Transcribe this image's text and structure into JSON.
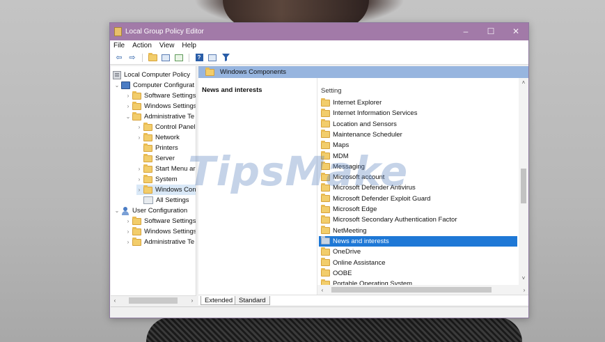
{
  "window": {
    "title": "Local Group Policy Editor",
    "minimize": "–",
    "maximize": "☐",
    "close": "✕"
  },
  "menu": [
    "File",
    "Action",
    "View",
    "Help"
  ],
  "toolbar": {
    "back_icon": "⇦",
    "forward_icon": "⇨"
  },
  "tree": {
    "items": [
      {
        "label": "Local Computer Policy"
      },
      {
        "label": "Computer Configurat"
      },
      {
        "label": "Software Settings"
      },
      {
        "label": "Windows Settings"
      },
      {
        "label": "Administrative Te"
      },
      {
        "label": "Control Panel"
      },
      {
        "label": "Network"
      },
      {
        "label": "Printers"
      },
      {
        "label": "Server"
      },
      {
        "label": "Start Menu ar"
      },
      {
        "label": "System"
      },
      {
        "label": "Windows Con"
      },
      {
        "label": "All Settings"
      },
      {
        "label": "User Configuration"
      },
      {
        "label": "Software Settings"
      },
      {
        "label": "Windows Settings"
      },
      {
        "label": "Administrative Te"
      }
    ]
  },
  "right": {
    "header": "Windows Components",
    "description_title": "News and interests",
    "column_header": "Setting",
    "settings": [
      "Internet Explorer",
      "Internet Information Services",
      "Location and Sensors",
      "Maintenance Scheduler",
      "Maps",
      "MDM",
      "Messaging",
      "Microsoft account",
      "Microsoft Defender Antivirus",
      "Microsoft Defender Exploit Guard",
      "Microsoft Edge",
      "Microsoft Secondary Authentication Factor",
      "NetMeeting",
      "News and interests",
      "OneDrive",
      "Online Assistance",
      "OOBE",
      "Portable Operating System"
    ],
    "selected": "News and interests"
  },
  "tabs": [
    "Extended",
    "Standard"
  ],
  "watermark": "TipsMake"
}
